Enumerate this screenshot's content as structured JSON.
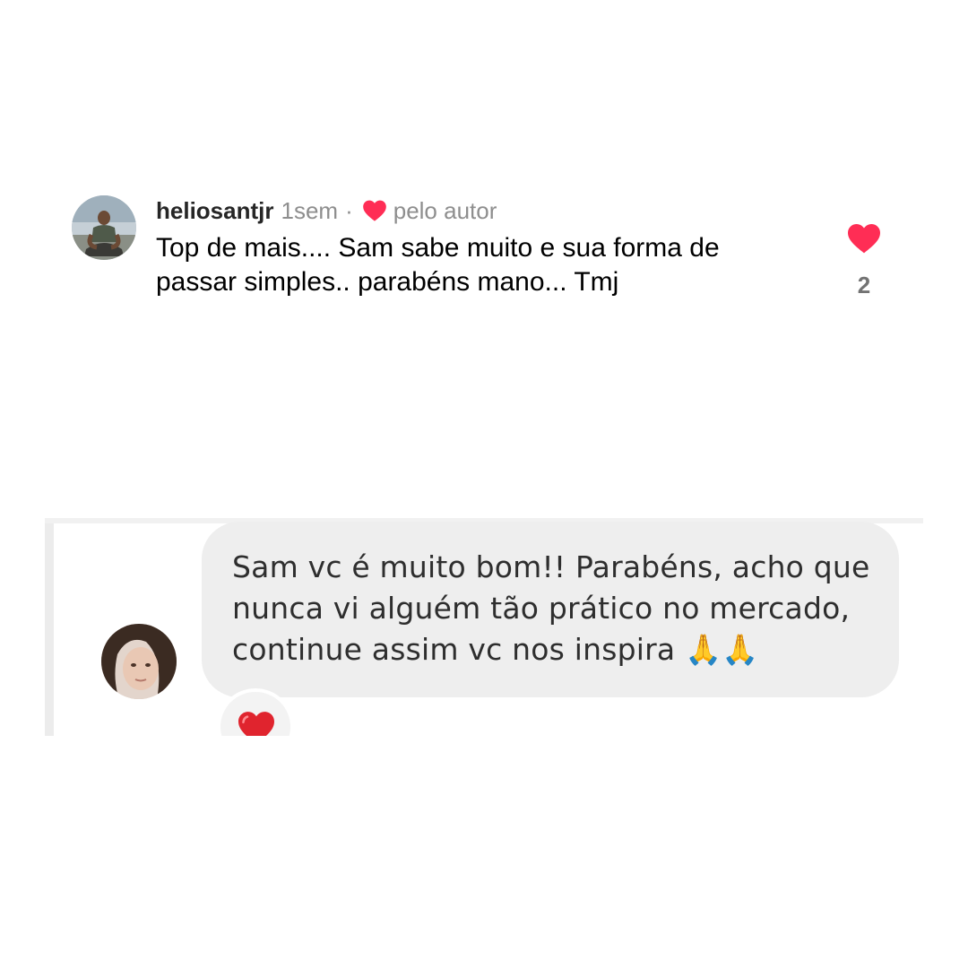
{
  "comment": {
    "username": "heliosantjr",
    "time": "1sem",
    "separator": "·",
    "liked_by_author_label": "pelo autor",
    "text": "Top de mais.... Sam sabe muito e sua forma de passar simples.. parabéns mano... Tmj",
    "like_count": "2",
    "liked": true,
    "like_color": "#ff2d55",
    "icons": {
      "author_heart": "heart-icon",
      "like": "heart-icon"
    }
  },
  "reply_screenshot": {
    "text": "Sam vc é muito bom!! Parabéns, acho que nunca vi alguém tão prático no mercado, continue assim vc nos inspira",
    "emojis": "🙏🙏",
    "reaction": "❤️",
    "bubble_color": "#eeeeee"
  }
}
